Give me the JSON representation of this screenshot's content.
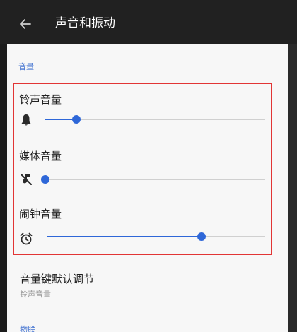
{
  "appbar": {
    "title": "声音和振动",
    "back_icon": "arrow-left-icon"
  },
  "section": {
    "label": "音量"
  },
  "volume_rows": [
    {
      "label": "铃声音量",
      "icon": "bell-icon",
      "level": 0.14
    },
    {
      "label": "媒体音量",
      "icon": "music-muted-icon",
      "level": 0.0
    },
    {
      "label": "闹钟音量",
      "icon": "alarm-clock-icon",
      "level": 0.71
    }
  ],
  "volume_key_setting": {
    "title": "音量键默认调节",
    "summary": "铃声音量"
  },
  "next_section": {
    "label": "物联"
  },
  "colors": {
    "accent": "#2e67d8",
    "highlight_border": "#e23535",
    "appbar_bg": "#212121",
    "content_bg": "#f7f7f7"
  }
}
